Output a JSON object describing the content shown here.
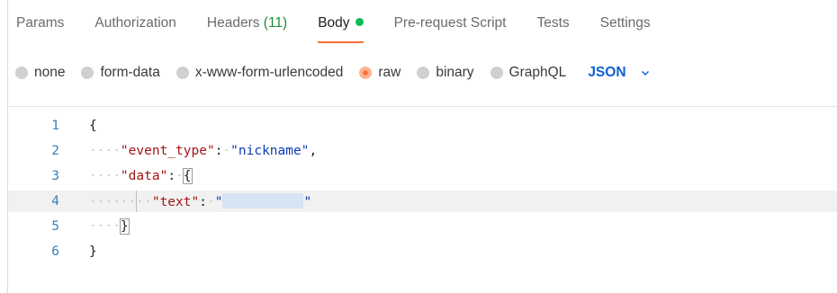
{
  "tabs": [
    {
      "label": "Params"
    },
    {
      "label": "Authorization"
    },
    {
      "label": "Headers",
      "count": "(11)"
    },
    {
      "label": "Body",
      "active": true
    },
    {
      "label": "Pre-request Script"
    },
    {
      "label": "Tests"
    },
    {
      "label": "Settings"
    }
  ],
  "body_types": [
    {
      "label": "none"
    },
    {
      "label": "form-data"
    },
    {
      "label": "x-www-form-urlencoded"
    },
    {
      "label": "raw",
      "selected": true
    },
    {
      "label": "binary"
    },
    {
      "label": "GraphQL"
    }
  ],
  "format_select": {
    "value": "JSON"
  },
  "editor": {
    "lines": [
      {
        "n": "1"
      },
      {
        "n": "2",
        "key": "\"event_type\"",
        "value": "\"nickname\""
      },
      {
        "n": "3",
        "key": "\"data\""
      },
      {
        "n": "4",
        "key": "\"text\"",
        "value_open": "\"",
        "value_close": "\""
      },
      {
        "n": "5"
      },
      {
        "n": "6"
      }
    ],
    "current_line": 4
  },
  "colors": {
    "accent": "#ff6c37",
    "active_dot": "#0cbb52",
    "headers_count": "#1a8f3c",
    "format_link": "#0b5fd7",
    "line_number": "#3a7fb8",
    "json_key": "#a31515",
    "json_string": "#0b3bb5"
  }
}
